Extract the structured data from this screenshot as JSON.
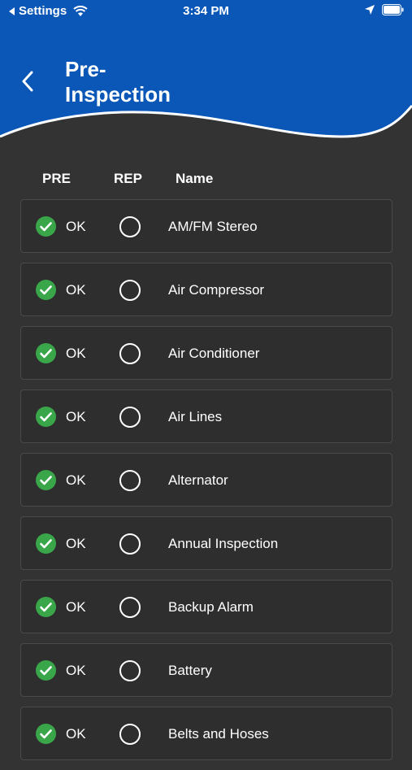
{
  "status_bar": {
    "back_app": "Settings",
    "time": "3:34 PM"
  },
  "header": {
    "title": "Pre-\nInspection",
    "background_color": "#0a57b8"
  },
  "columns": {
    "pre": "PRE",
    "rep": "REP",
    "name": "Name"
  },
  "items": [
    {
      "status": "OK",
      "name": "AM/FM Stereo"
    },
    {
      "status": "OK",
      "name": "Air Compressor"
    },
    {
      "status": "OK",
      "name": "Air Conditioner"
    },
    {
      "status": "OK",
      "name": "Air Lines"
    },
    {
      "status": "OK",
      "name": "Alternator"
    },
    {
      "status": "OK",
      "name": "Annual Inspection"
    },
    {
      "status": "OK",
      "name": "Backup Alarm"
    },
    {
      "status": "OK",
      "name": "Battery"
    },
    {
      "status": "OK",
      "name": "Belts and Hoses"
    }
  ],
  "colors": {
    "check_green": "#3aa64a",
    "background": "#333333"
  }
}
